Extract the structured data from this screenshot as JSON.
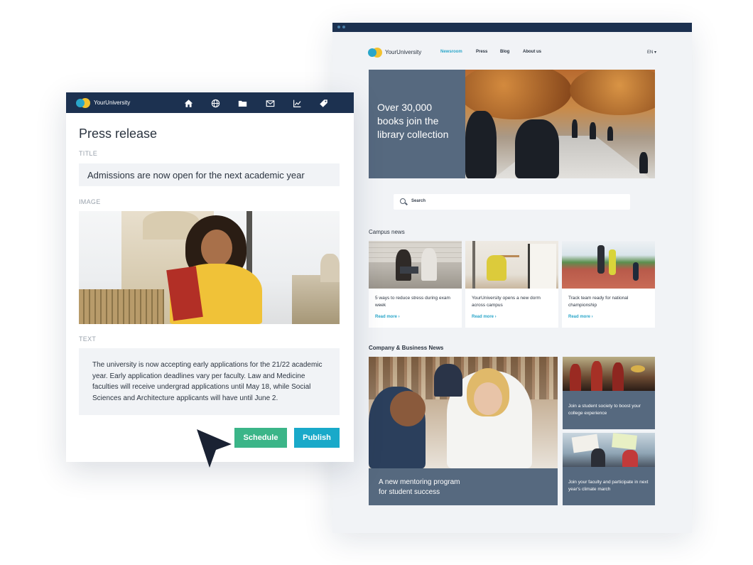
{
  "site": {
    "logo_text": "YourUniversity",
    "nav": [
      {
        "label": "Newsroom",
        "active": true
      },
      {
        "label": "Press",
        "active": false
      },
      {
        "label": "Blog",
        "active": false
      },
      {
        "label": "About us",
        "active": false
      }
    ],
    "language": "EN ▾",
    "hero": {
      "lines": [
        "Over 30,000",
        "books join the",
        "library collection"
      ]
    },
    "search": {
      "placeholder": "Search"
    },
    "campus_news": {
      "title": "Campus news",
      "cards": [
        {
          "caption": "5 ways to reduce stress during exam week",
          "more": "Read more ›"
        },
        {
          "caption": "YourUniversity opens a new dorm across campus",
          "more": "Read more ›"
        },
        {
          "caption": "Track team ready for national championship",
          "more": "Read more ›"
        }
      ]
    },
    "business_news": {
      "title": "Company & Business News",
      "main": {
        "lines": [
          "A new mentoring program",
          "for student success"
        ]
      },
      "side": [
        {
          "caption": "Join a student society to boost your college experience"
        },
        {
          "caption": "Join your faculty and participate in next year's climate march"
        }
      ]
    }
  },
  "editor": {
    "logo_text": "YourUniversity",
    "toolbar_icons": [
      "home-icon",
      "globe-icon",
      "folder-icon",
      "mail-icon",
      "chart-icon",
      "tag-icon"
    ],
    "title": "Press release",
    "title_label": "TITLE",
    "title_value": "Admissions are now open for the next academic year",
    "image_label": "IMAGE",
    "text_label": "TEXT",
    "text_value": "The university is now accepting early applications for the 21/22 academic year. Early application deadlines vary per faculty. Law and Medicine faculties will receive undergrad applications until May 18, while Social Sciences and Architecture applicants will have until June 2.",
    "schedule_label": "Schedule",
    "publish_label": "Publish"
  },
  "colors": {
    "navy": "#1c3150",
    "slate": "#56697f",
    "teal_link": "#2aa6c9",
    "schedule_green": "#3bb588",
    "publish_blue": "#19a9c9",
    "logo_blue": "#2aa6c9",
    "logo_yellow": "#f2c230"
  }
}
